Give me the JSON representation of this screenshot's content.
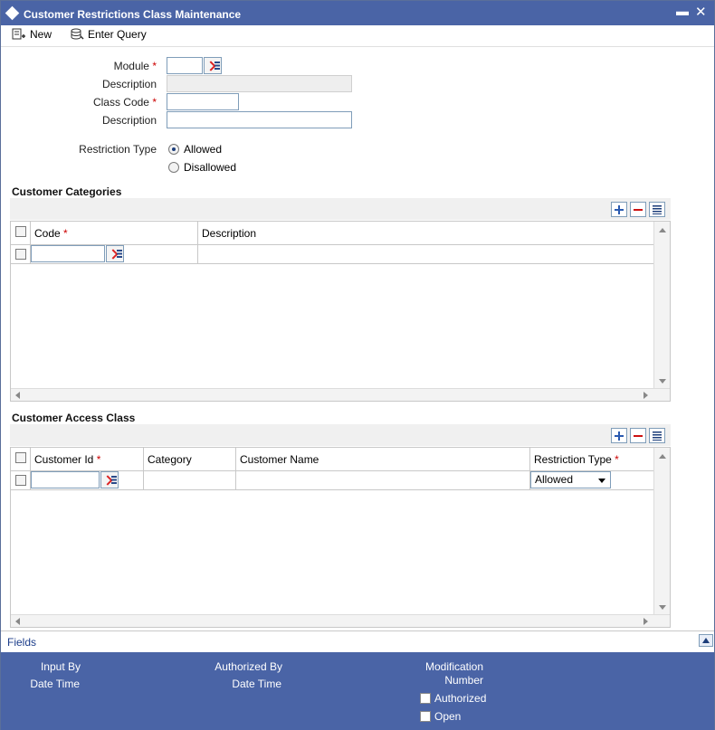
{
  "window": {
    "title": "Customer Restrictions Class Maintenance",
    "minimize_glyph": "▬",
    "close_glyph": "✕"
  },
  "toolbar": {
    "new_label": "New",
    "enter_query_label": "Enter Query"
  },
  "form": {
    "module_label": "Module",
    "module_value": "",
    "description_label": "Description",
    "description_value": "",
    "class_code_label": "Class Code",
    "class_code_value": "",
    "class_description_label": "Description",
    "class_description_value": "",
    "restriction_type_label": "Restriction Type",
    "restriction_options": [
      "Allowed",
      "Disallowed"
    ],
    "restriction_selected": "Allowed",
    "required_marker": "*"
  },
  "customer_categories": {
    "title": "Customer Categories",
    "columns": [
      "Code",
      "Description"
    ]
  },
  "customer_access_class": {
    "title": "Customer Access Class",
    "columns": [
      "Customer Id",
      "Category",
      "Customer Name",
      "Restriction Type"
    ],
    "row_restriction_value": "Allowed"
  },
  "footer": {
    "fields_link": "Fields",
    "input_by": "Input By",
    "date_time_1": "Date Time",
    "authorized_by": "Authorized By",
    "date_time_2": "Date Time",
    "modification": "Modification",
    "number": "Number",
    "authorized": "Authorized",
    "open": "Open"
  },
  "colors": {
    "titlebar": "#4a64a6",
    "required": "#cc0000",
    "link": "#1c3d8a"
  }
}
